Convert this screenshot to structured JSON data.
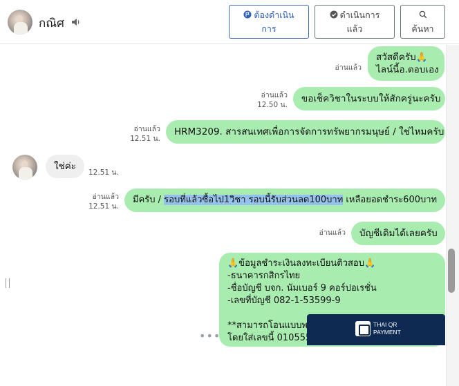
{
  "header": {
    "contact_name": "กณิศ",
    "buttons": {
      "todo": [
        "ต้องดำเนิน",
        "การ"
      ],
      "done": [
        "ดำเนินการ",
        "แล้ว"
      ],
      "search": "ค้นหา"
    }
  },
  "messages": [
    {
      "side": "me",
      "lines": [
        "สวัสดีครับ🙏",
        "ไลน์นี้อ.ตอบเอง"
      ],
      "read": "อ่านแล้ว",
      "time": ""
    },
    {
      "side": "me",
      "lines": [
        "ขอเช็ควิชาในระบบให้สักครู่นะครับ"
      ],
      "read": "อ่านแล้ว",
      "time": "12.50 น."
    },
    {
      "side": "me",
      "lines": [
        "HRM3209. สารสนเทศเพื่อการจัดการทรัพยากรมนุษย์ / ใช่ไหมครับ"
      ],
      "read": "อ่านแล้ว",
      "time": "12.51 น."
    },
    {
      "side": "them",
      "lines": [
        "ใช่ค่ะ"
      ],
      "time": "12.51 น."
    },
    {
      "side": "me",
      "parts": [
        "มีครับ / ",
        "รอบที่แล้วซื้อไป1วิชา รอบนี้รับส่วนลด100บาท",
        " เหลือยอดชำระ600บาท"
      ],
      "read": "อ่านแล้ว",
      "time": "12.51 น."
    },
    {
      "side": "me",
      "lines": [
        "บัญชีเดิมได้เลยครับ"
      ],
      "read": "อ่านแล้ว",
      "time": ""
    },
    {
      "side": "me",
      "lines": [
        "🙏ข้อมูลชำระเงินลงทะเบียนติวสอบ🙏",
        "-ธนาคารกสิกรไทย",
        "-ชื่อบัญชี บจก. นัมเบอร์ 9 คอร์ปอเรชั่น",
        "-เลขที่บัญชี 082-1-53599-9",
        "",
        "**สามารถโอนแบบพร้อมเพย์ได้ ฟรี!ค่าธรรมเนียม",
        "โดยใส่เลขนี้ 0105559148589 (เลขประจำตัว13หลัก)"
      ]
    }
  ],
  "qr_card": {
    "line1": "THAI QR",
    "line2": "PAYMENT"
  },
  "more_dots": "•••",
  "colors": {
    "my_bubble": "#a8ecb0",
    "their_bubble": "#efefef",
    "highlight": "#94c2ec",
    "primary_button": "#2f5db0"
  }
}
